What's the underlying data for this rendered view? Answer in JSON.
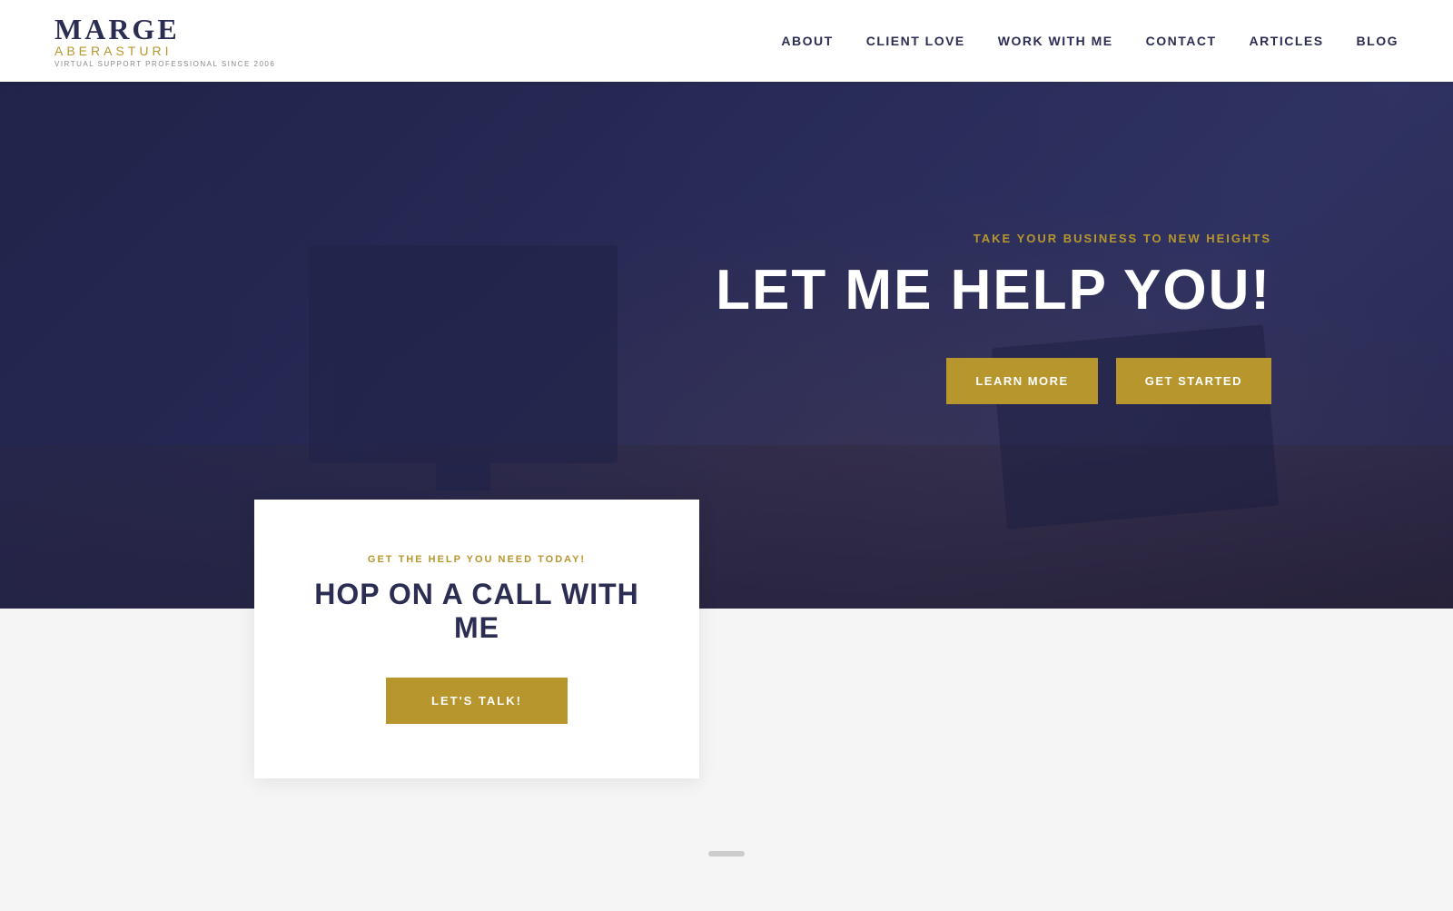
{
  "header": {
    "logo": {
      "name_line1": "MARGE",
      "name_line2": "ABERASTURI",
      "tagline": "VIRTUAL SUPPORT PROFESSIONAL SINCE 2006"
    },
    "nav": {
      "items": [
        {
          "label": "ABOUT",
          "id": "about"
        },
        {
          "label": "CLIENT LOVE",
          "id": "client-love"
        },
        {
          "label": "WORK WITH ME",
          "id": "work-with-me"
        },
        {
          "label": "CONTACT",
          "id": "contact"
        },
        {
          "label": "ARTICLES",
          "id": "articles"
        },
        {
          "label": "BLOG",
          "id": "blog"
        }
      ]
    }
  },
  "hero": {
    "subtitle": "TAKE YOUR BUSINESS TO NEW HEIGHTS",
    "title": "LET ME HELP YOU!",
    "btn_learn": "LEARN MORE",
    "btn_start": "GET STARTED"
  },
  "card": {
    "label": "GET THE HELP YOU NEED TODAY!",
    "heading": "HOP ON A CALL WITH ME",
    "btn_talk": "LET'S TALK!"
  },
  "colors": {
    "gold": "#b8962e",
    "navy": "#2b2d52",
    "hero_bg": "#2e3060",
    "white": "#ffffff"
  }
}
